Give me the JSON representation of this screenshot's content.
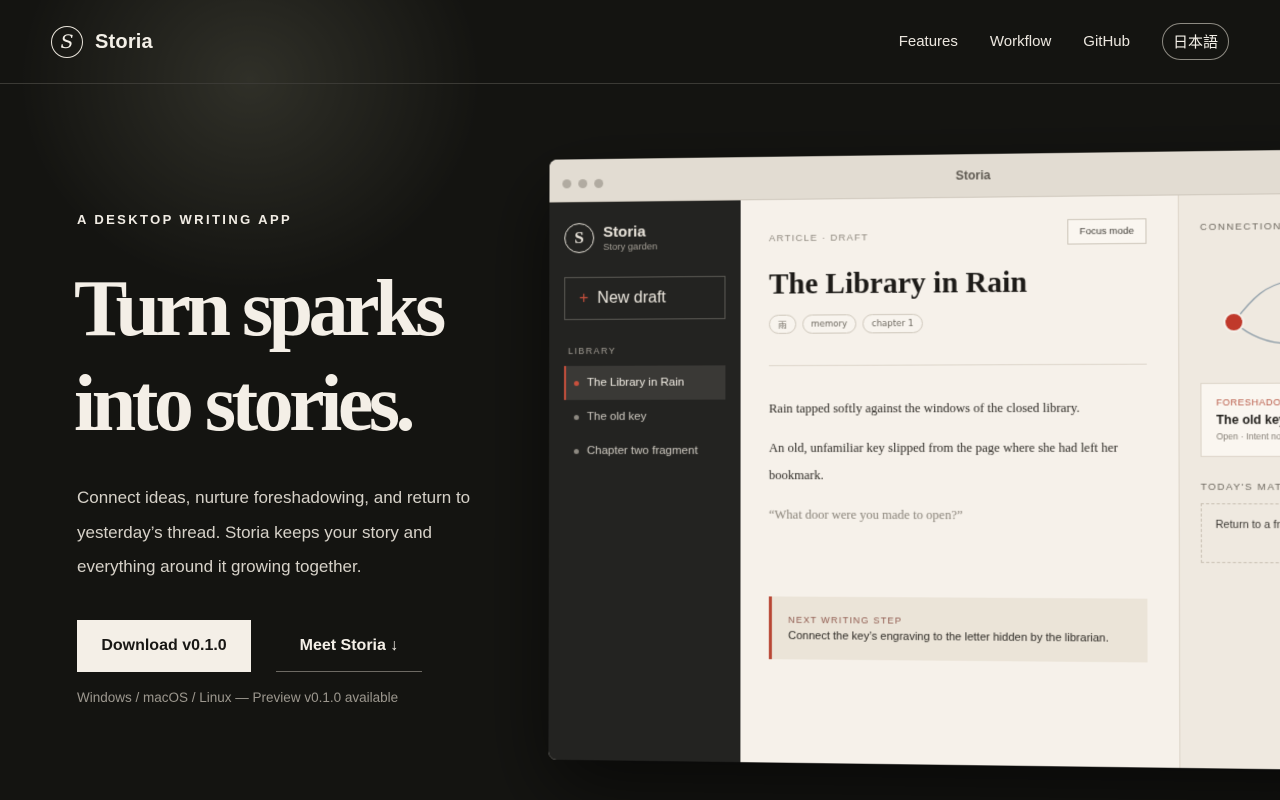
{
  "nav": {
    "brand_logo": "S",
    "brand_name": "Storia",
    "links": [
      "Features",
      "Workflow",
      "GitHub"
    ],
    "lang": "日本語"
  },
  "hero": {
    "eyebrow": "A DESKTOP WRITING APP",
    "headline_1": "Turn sparks",
    "headline_2": "into stories.",
    "lead": "Connect ideas, nurture foreshadowing, and return to yesterday’s thread. Storia keeps your story and everything around it growing together.",
    "download_label": "Download v0.1.0",
    "meet_label": "Meet Storia ↓",
    "platforms": "Windows / macOS / Linux — Preview v0.1.0 available"
  },
  "app": {
    "window_title": "Storia",
    "sidebar": {
      "logo": "S",
      "name": "Storia",
      "subtitle": "Story garden",
      "new_draft_plus": "+",
      "new_draft": "New draft",
      "section": "LIBRARY",
      "items": [
        {
          "label": "The Library in Rain",
          "active": true
        },
        {
          "label": "The old key",
          "active": false
        },
        {
          "label": "Chapter two fragment",
          "active": false
        }
      ]
    },
    "editor": {
      "meta": "ARTICLE · DRAFT",
      "focus_mode": "Focus mode",
      "title": "The Library in Rain",
      "tags": [
        "雨",
        "memory",
        "chapter 1"
      ],
      "paragraph_1": "Rain tapped softly against the windows of the closed library.",
      "paragraph_2": "An old, unfamiliar key slipped from the page where she had left her bookmark.",
      "quote": "“What door were you made to open?”",
      "next_label": "NEXT WRITING STEP",
      "next_text": "Connect the key’s engraving to the letter hidden by the librarian."
    },
    "right_panel": {
      "connections": "CONNECTIONS",
      "card_tag": "FORESHADOWING",
      "card_title": "The old key",
      "card_meta": "Open · Intent noted",
      "materials": "TODAY'S MATERIALS",
      "material_text": "Return to a fragment from last week"
    }
  },
  "colors": {
    "accent": "#c9503d",
    "background": "#141411",
    "paper": "#f6f1ea",
    "sidebar": "#232321"
  }
}
